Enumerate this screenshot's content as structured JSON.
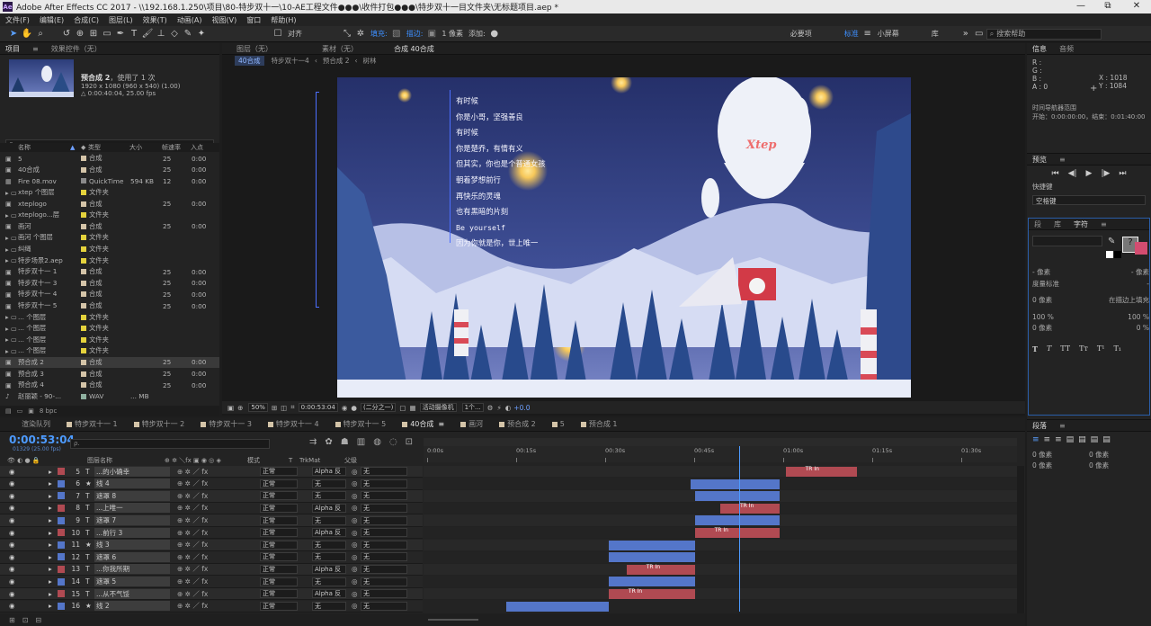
{
  "window": {
    "title": "Adobe After Effects CC 2017 - \\\\192.168.1.250\\项目\\80-特步双十一\\10-AE工程文件●●●\\收件打包●●●\\特步双十一目文件夹\\无标题项目.aep *",
    "logo": "Ae",
    "minimize": "—",
    "maximize": "⧉",
    "close": "✕"
  },
  "menu": [
    "文件(F)",
    "编辑(E)",
    "合成(C)",
    "图层(L)",
    "效果(T)",
    "动画(A)",
    "视图(V)",
    "窗口",
    "帮助(H)"
  ],
  "toolbar": {
    "snap_label": "对齐",
    "fill_label": "填充:",
    "stroke_label": "描边:",
    "stroke_px": "1 像素",
    "add_label": "添加:",
    "workspaces": [
      "必要项",
      "标准",
      "小屏幕",
      "库"
    ],
    "active_workspace": "标准",
    "search_placeholder": "搜索帮助"
  },
  "project": {
    "tab_project": "项目",
    "tab_effects": "效果控件（无）",
    "comp_name": "预合成 2",
    "usage": "，使用了 1 次",
    "size": "1920 x 1080 (960 x 540) (1.00)",
    "duration": "△ 0:00:40:04, 25.00 fps",
    "search_placeholder": "ρ.",
    "columns": [
      "名称",
      "类型",
      "大小",
      "帧速率",
      "入点"
    ],
    "items": [
      {
        "name": "5",
        "type": "合成",
        "size": "",
        "fps": "25",
        "in": "0:00",
        "color": "#d4c4a8",
        "kind": "comp"
      },
      {
        "name": "40合成",
        "type": "合成",
        "size": "",
        "fps": "25",
        "in": "0:00",
        "color": "#d4c4a8",
        "kind": "comp"
      },
      {
        "name": "Fire 08.mov",
        "type": "QuickTime",
        "size": "594 KB",
        "fps": "12",
        "in": "0:00",
        "color": "#8a8a8a",
        "kind": "file"
      },
      {
        "name": "xtep 个图层",
        "type": "文件夹",
        "size": "",
        "fps": "",
        "in": "",
        "color": "#e4d23c",
        "kind": "folder"
      },
      {
        "name": "xteplogo",
        "type": "合成",
        "size": "",
        "fps": "25",
        "in": "0:00",
        "color": "#d4c4a8",
        "kind": "comp"
      },
      {
        "name": "xteplogo...层",
        "type": "文件夹",
        "size": "",
        "fps": "",
        "in": "",
        "color": "#e4d23c",
        "kind": "folder"
      },
      {
        "name": "画河",
        "type": "合成",
        "size": "",
        "fps": "25",
        "in": "0:00",
        "color": "#d4c4a8",
        "kind": "comp"
      },
      {
        "name": "画河 个图层",
        "type": "文件夹",
        "size": "",
        "fps": "",
        "in": "",
        "color": "#e4d23c",
        "kind": "folder"
      },
      {
        "name": "纠绳",
        "type": "文件夹",
        "size": "",
        "fps": "",
        "in": "",
        "color": "#e4d23c",
        "kind": "folder"
      },
      {
        "name": "特步场景2.aep",
        "type": "文件夹",
        "size": "",
        "fps": "",
        "in": "",
        "color": "#e4d23c",
        "kind": "folder"
      },
      {
        "name": "特步双十一 1",
        "type": "合成",
        "size": "",
        "fps": "25",
        "in": "0:00",
        "color": "#d4c4a8",
        "kind": "comp"
      },
      {
        "name": "特步双十一 3",
        "type": "合成",
        "size": "",
        "fps": "25",
        "in": "0:00",
        "color": "#d4c4a8",
        "kind": "comp"
      },
      {
        "name": "特步双十一 4",
        "type": "合成",
        "size": "",
        "fps": "25",
        "in": "0:00",
        "color": "#d4c4a8",
        "kind": "comp"
      },
      {
        "name": "特步双十一 5",
        "type": "合成",
        "size": "",
        "fps": "25",
        "in": "0:00",
        "color": "#d4c4a8",
        "kind": "comp"
      },
      {
        "name": "... 个图层",
        "type": "文件夹",
        "size": "",
        "fps": "",
        "in": "",
        "color": "#e4d23c",
        "kind": "folder"
      },
      {
        "name": "... 个图层",
        "type": "文件夹",
        "size": "",
        "fps": "",
        "in": "",
        "color": "#e4d23c",
        "kind": "folder"
      },
      {
        "name": "... 个图层",
        "type": "文件夹",
        "size": "",
        "fps": "",
        "in": "",
        "color": "#e4d23c",
        "kind": "folder"
      },
      {
        "name": "... 个图层",
        "type": "文件夹",
        "size": "",
        "fps": "",
        "in": "",
        "color": "#e4d23c",
        "kind": "folder"
      },
      {
        "name": "预合成 2",
        "type": "合成",
        "size": "",
        "fps": "25",
        "in": "0:00",
        "color": "#d4c4a8",
        "kind": "comp",
        "selected": true
      },
      {
        "name": "预合成 3",
        "type": "合成",
        "size": "",
        "fps": "25",
        "in": "0:00",
        "color": "#d4c4a8",
        "kind": "comp"
      },
      {
        "name": "预合成 4",
        "type": "合成",
        "size": "",
        "fps": "25",
        "in": "0:00",
        "color": "#d4c4a8",
        "kind": "comp"
      },
      {
        "name": "赵丽颖 - 90-...",
        "type": "WAV",
        "size": "... MB",
        "fps": "",
        "in": "",
        "color": "#8fb0a0",
        "kind": "audio"
      }
    ],
    "bpc": "8 bpc"
  },
  "viewer": {
    "tabs": [
      "图层（无）",
      "素材（无）",
      "合成 40合成"
    ],
    "active_tab": "合成 40合成",
    "breadcrumbs": [
      "40合成",
      "特步双十一4",
      "预合成 2",
      "树林"
    ],
    "zoom": "50%",
    "timecode": "0:00:53:04",
    "resolution": "(二分之一)",
    "camera": "活动摄像机",
    "view": "1个...",
    "exposure": "+0.0",
    "lyrics": [
      "有时候",
      "你是小哥，坚强善良",
      "有时候",
      "你是楚乔，有情有义",
      "但其实，你也是个普通女孩",
      "朝着梦想前行",
      "再快乐的灵魂",
      "也有黑暗的片刻",
      "Be yourself",
      "因为你就是你，世上唯一"
    ],
    "balloon_logo": "Xtep"
  },
  "timeline": {
    "tabs": [
      "渲染队列",
      "特步双十一 1",
      "特步双十一 2",
      "特步双十一 3",
      "特步双十一 4",
      "特步双十一 5",
      "40合成",
      "画河",
      "预合成 2",
      "5",
      "预合成 1"
    ],
    "active_tab": "40合成",
    "timecode": "0:00:53:04",
    "frame_info": "01329 (25.00 fps)",
    "search_placeholder": "ρ.",
    "headers": [
      "图层名称",
      "模式",
      "T",
      "TrkMat",
      "父级"
    ],
    "ruler": [
      "0:00s",
      "00:15s",
      "00:30s",
      "00:45s",
      "01:00s",
      "01:15s",
      "01:30s"
    ],
    "layers": [
      {
        "num": "5",
        "type": "T",
        "name": "...的小确幸",
        "mode": "正常",
        "trk": "Alpha 反",
        "parent": "无",
        "color": "#b04a52",
        "bar": {
          "c": "red",
          "s": 61.0,
          "e": 73.0
        },
        "key": "TR In"
      },
      {
        "num": "6",
        "type": "★",
        "name": "线 4",
        "mode": "正常",
        "trk": "无",
        "parent": "无",
        "color": "#5476c9",
        "bar": {
          "c": "blue",
          "s": 45.0,
          "e": 60.0
        }
      },
      {
        "num": "7",
        "type": "T",
        "name": "遮罩 8",
        "mode": "正常",
        "trk": "无",
        "parent": "无",
        "color": "#5476c9",
        "bar": {
          "c": "blue",
          "s": 45.7,
          "e": 60.0
        }
      },
      {
        "num": "8",
        "type": "T",
        "name": "...上唯一",
        "mode": "正常",
        "trk": "Alpha 反",
        "parent": "无",
        "color": "#b04a52",
        "bar": {
          "c": "red",
          "s": 50.0,
          "e": 60.0
        },
        "key": "TR In"
      },
      {
        "num": "9",
        "type": "T",
        "name": "遮罩 7",
        "mode": "正常",
        "trk": "无",
        "parent": "无",
        "color": "#5476c9",
        "bar": {
          "c": "blue",
          "s": 45.7,
          "e": 60.0
        }
      },
      {
        "num": "10",
        "type": "T",
        "name": "...前行 3",
        "mode": "正常",
        "trk": "Alpha 反",
        "parent": "无",
        "color": "#b04a52",
        "bar": {
          "c": "red",
          "s": 45.7,
          "e": 60.0
        },
        "key": "TR In"
      },
      {
        "num": "11",
        "type": "★",
        "name": "线 3",
        "mode": "正常",
        "trk": "无",
        "parent": "无",
        "color": "#5476c9",
        "bar": {
          "c": "blue",
          "s": 31.2,
          "e": 45.7
        }
      },
      {
        "num": "12",
        "type": "T",
        "name": "遮罩 6",
        "mode": "正常",
        "trk": "无",
        "parent": "无",
        "color": "#5476c9",
        "bar": {
          "c": "blue",
          "s": 31.2,
          "e": 45.7
        }
      },
      {
        "num": "13",
        "type": "T",
        "name": "...你我所期",
        "mode": "正常",
        "trk": "Alpha 反",
        "parent": "无",
        "color": "#b04a52",
        "bar": {
          "c": "red",
          "s": 34.2,
          "e": 45.7
        },
        "key": "TR In"
      },
      {
        "num": "14",
        "type": "T",
        "name": "遮罩 5",
        "mode": "正常",
        "trk": "无",
        "parent": "无",
        "color": "#5476c9",
        "bar": {
          "c": "blue",
          "s": 31.2,
          "e": 45.7
        }
      },
      {
        "num": "15",
        "type": "T",
        "name": "...从不气馁",
        "mode": "正常",
        "trk": "Alpha 反",
        "parent": "无",
        "color": "#b04a52",
        "bar": {
          "c": "red",
          "s": 31.2,
          "e": 45.7
        },
        "key": "TR In"
      },
      {
        "num": "16",
        "type": "★",
        "name": "线 2",
        "mode": "正常",
        "trk": "无",
        "parent": "无",
        "color": "#5476c9",
        "bar": {
          "c": "blue",
          "s": 14.0,
          "e": 31.2
        }
      }
    ],
    "playhead_sec": 53.16,
    "total_sec": 100
  },
  "info": {
    "tab_info": "信息",
    "tab_audio": "音频",
    "r": "R :",
    "g": "G :",
    "b": "B :",
    "a": "A : 0",
    "x": "X : 1018",
    "y": "Y : 1084",
    "nav_title": "时间导航器范围",
    "nav_range": "开始：0:00:00:00，结束：0:01:40:00"
  },
  "preview": {
    "title": "预览",
    "shortcut_label": "快捷键",
    "shortcut_value": "空格键"
  },
  "character": {
    "tabs": [
      "段",
      "库",
      "字符"
    ],
    "active": "字符",
    "size": "- 像素",
    "leading": "- 像素",
    "tracking": "度量标准",
    "kerning": "-",
    "stroke_w": "0 像素",
    "stroke_mode": "在描边上填充",
    "vscale": "100 %",
    "hscale": "100 %",
    "baseline": "0 像素",
    "tsume": "0 %",
    "styles": [
      "T",
      "T",
      "TT",
      "Tт",
      "T¹",
      "T₁"
    ]
  },
  "paragraph": {
    "title": "段落",
    "indent": "0 像素",
    "space": "0 像素"
  }
}
